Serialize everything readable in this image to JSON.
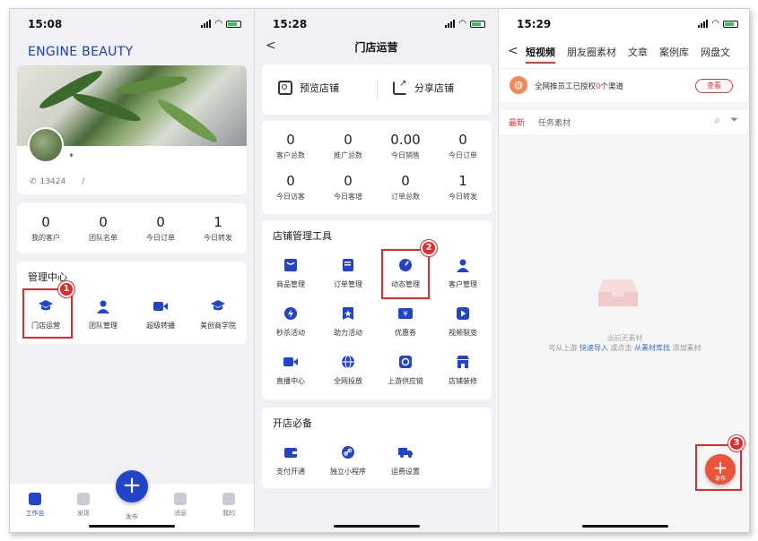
{
  "screen1": {
    "time": "15:08",
    "brand": "ENGINE BEAUTY",
    "star": "*",
    "phone": "13424",
    "phone_sep": "/",
    "stats": [
      {
        "value": "0",
        "label": "我的客户"
      },
      {
        "value": "0",
        "label": "团队名单"
      },
      {
        "value": "0",
        "label": "今日订单"
      },
      {
        "value": "1",
        "label": "今日转发"
      }
    ],
    "section_title": "管理中心",
    "menu": [
      "门店运营",
      "团队管理",
      "超级转播",
      "美创商学院"
    ],
    "tabs": [
      "工作台",
      "发现",
      "发布",
      "消息",
      "我的"
    ],
    "fab_symbol": "+",
    "badge": "1",
    "accent": "#2343c9"
  },
  "screen2": {
    "time": "15:28",
    "title": "门店运营",
    "back": "<",
    "preview_label": "预览店铺",
    "share_label": "分享店铺",
    "stats_row1": [
      {
        "value": "0",
        "label": "客户总数"
      },
      {
        "value": "0",
        "label": "推广总数"
      },
      {
        "value": "0.00",
        "label": "今日销售"
      },
      {
        "value": "0",
        "label": "今日订单"
      }
    ],
    "stats_row2": [
      {
        "value": "0",
        "label": "今日访客"
      },
      {
        "value": "0",
        "label": "今日客增"
      },
      {
        "value": "0",
        "label": "订单总数"
      },
      {
        "value": "1",
        "label": "今日转发"
      }
    ],
    "tools_title": "店铺管理工具",
    "tools": [
      "商品管理",
      "订单管理",
      "动态管理",
      "客户管理",
      "秒杀活动",
      "助力活动",
      "优惠券",
      "视频裂变",
      "直播中心",
      "全网投放",
      "上游供应链",
      "店铺装修"
    ],
    "open_title": "开店必备",
    "open_items": [
      "支付开通",
      "独立小程序",
      "运费设置"
    ],
    "badge": "2"
  },
  "screen3": {
    "time": "15:29",
    "back": "<",
    "tabs": [
      "短视频",
      "朋友圈素材",
      "文章",
      "案例库",
      "网盘文"
    ],
    "auth_prefix": "全网推员工已授权",
    "auth_count": "0",
    "auth_suffix": "个渠道",
    "view_label": "查看",
    "sub_latest": "最新",
    "sub_task": "任务素材",
    "empty_title": "当前无素材",
    "empty_hint_1": "可从上游",
    "empty_link_1": "快速导入",
    "empty_hint_2": "或点击",
    "empty_link_2": "从素材库找",
    "empty_hint_3": "添加素材",
    "publish_label": "发布",
    "publish_symbol": "+",
    "badge": "3",
    "accent": "#e8553a"
  }
}
